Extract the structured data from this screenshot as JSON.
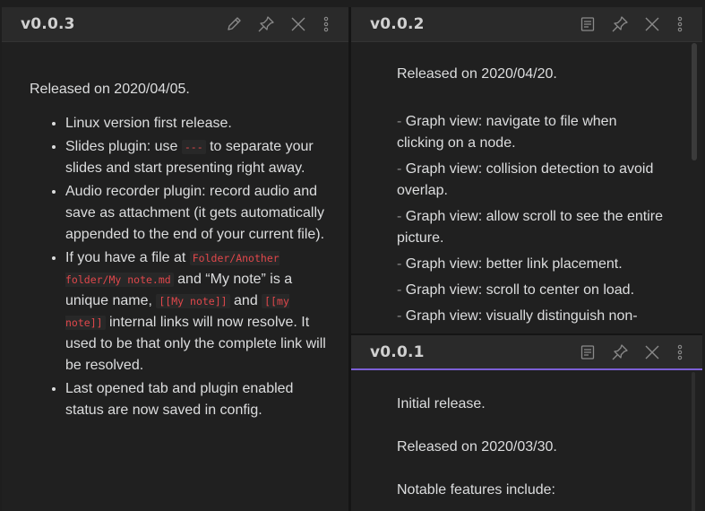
{
  "panes": {
    "v003": {
      "title": "v0.0.3",
      "released": "Released on 2020/04/05.",
      "items": [
        [
          "Linux version first release."
        ],
        [
          "Slides plugin: use ",
          {
            "code": "---"
          },
          " to separate your slides and start presenting right away."
        ],
        [
          "Audio recorder plugin: record audio and save as attachment (it gets automatically appended to the end of your current file)."
        ],
        [
          "If you have a file at ",
          {
            "code": "Folder/Another folder/My note.md"
          },
          " and “My note” is a unique name, ",
          {
            "code": "[[My note]]"
          },
          " and ",
          {
            "code": "[[my note]]"
          },
          " internal links will now resolve. It used to be that only the complete link will be resolved."
        ],
        [
          "Last opened tab and plugin enabled status are now saved in config."
        ]
      ]
    },
    "v002": {
      "title": "v0.0.2",
      "released": "Released on 2020/04/20.",
      "lines": [
        "Graph view: navigate to file when clicking on a node.",
        "Graph view: collision detection to avoid overlap.",
        "Graph view: allow scroll to see the entire picture.",
        "Graph view: better link placement.",
        "Graph view: scroll to center on load.",
        "Graph view: visually distinguish non-"
      ]
    },
    "v001": {
      "title": "v0.0.1",
      "lines": [
        "Initial release.",
        "Released on 2020/03/30.",
        "Notable features include:"
      ]
    }
  },
  "colors": {
    "active_accent": "#7c5fd6",
    "code": "#e0474b"
  },
  "icons": [
    "edit-icon",
    "preview-icon",
    "pin-icon",
    "close-icon",
    "more-options-icon"
  ]
}
